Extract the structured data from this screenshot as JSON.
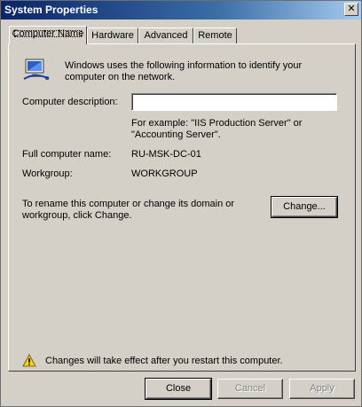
{
  "window": {
    "title": "System Properties",
    "close_glyph": "✕"
  },
  "tabs": [
    {
      "label": "Computer Name",
      "active": true
    },
    {
      "label": "Hardware",
      "active": false
    },
    {
      "label": "Advanced",
      "active": false
    },
    {
      "label": "Remote",
      "active": false
    }
  ],
  "computer_name": {
    "intro": "Windows uses the following information to identify your computer on the network.",
    "description_label": "Computer description:",
    "description_value": "",
    "example_text": "For example: \"IIS Production Server\" or \"Accounting Server\".",
    "full_name_label": "Full computer name:",
    "full_name_value": "RU-MSK-DC-01",
    "workgroup_label": "Workgroup:",
    "workgroup_value": "WORKGROUP",
    "rename_text": "To rename this computer or change its domain or workgroup, click Change.",
    "change_button": "Change...",
    "warning_text": "Changes will take effect after you restart this computer."
  },
  "footer": {
    "close_button": "Close",
    "cancel_button": "Cancel",
    "apply_button": "Apply"
  },
  "colors": {
    "face": "#d4d0c8",
    "title_start": "#0a246a",
    "title_end": "#a6caf0",
    "disabled_text": "#808080",
    "warning_yellow": "#f5d31a"
  },
  "icons": {
    "computer": "computer-network-icon",
    "warning": "warning-icon"
  }
}
